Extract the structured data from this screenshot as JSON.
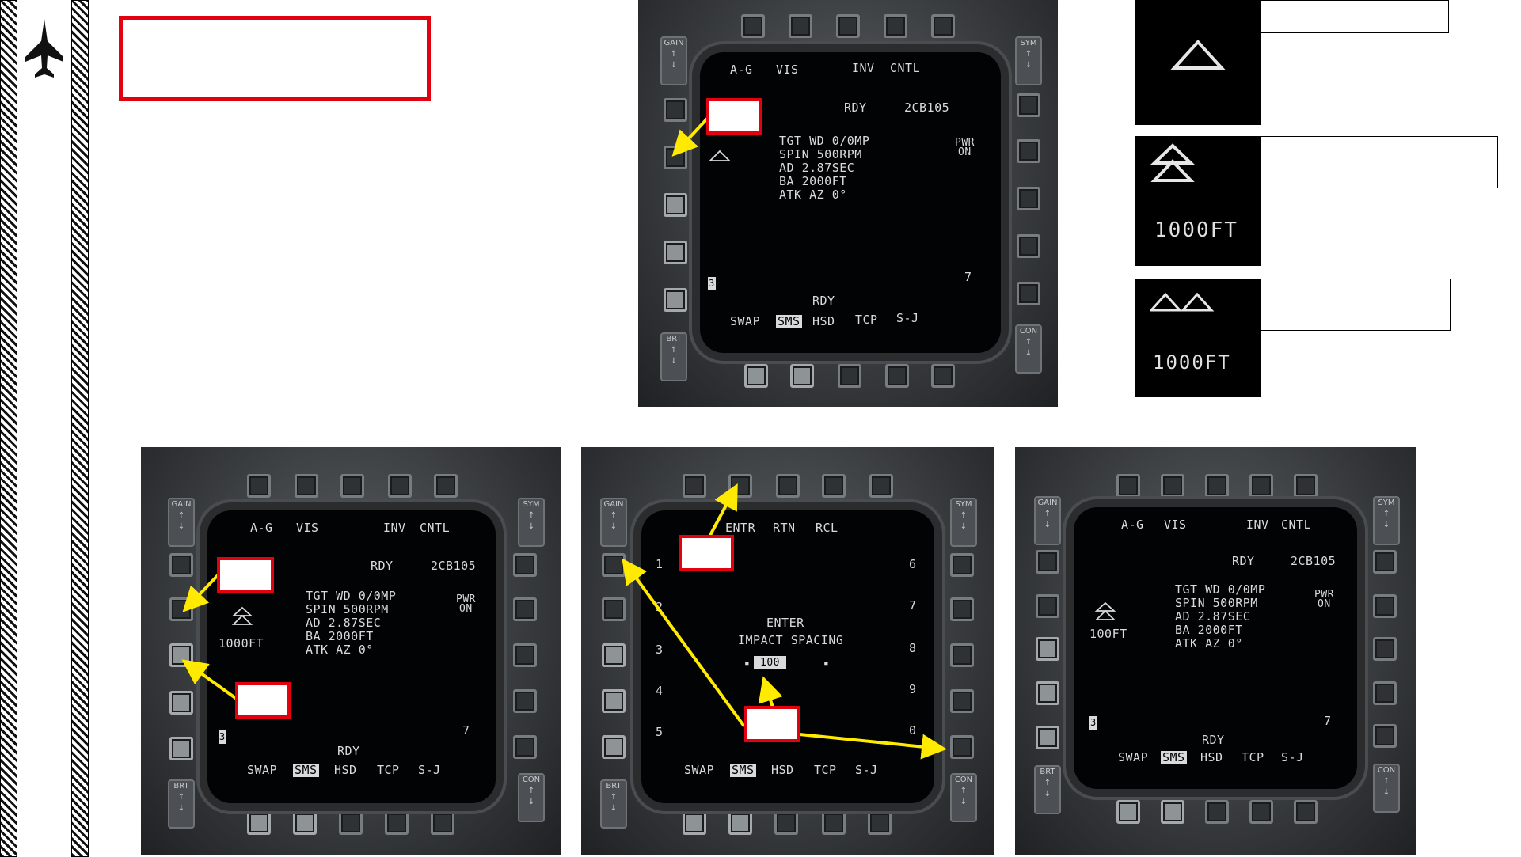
{
  "sidebar": {
    "icon": "jet-icon"
  },
  "title_box": {
    "text": ""
  },
  "symbols": {
    "single": {
      "label": ""
    },
    "pair": {
      "value": "1000FT",
      "label": ""
    },
    "ripple": {
      "value": "1000FT",
      "label": ""
    }
  },
  "mfd_top": {
    "tabs": [
      "A-G",
      "VIS",
      "INV",
      "CNTL"
    ],
    "rdy": "RDY",
    "code": "2CB105",
    "info": [
      "TGT WD 0/0MP",
      "SPIN 500RPM",
      "AD 2.87SEC",
      "BA 2000FT",
      "ATK AZ 0°"
    ],
    "pwr": [
      "PWR",
      "ON"
    ],
    "qty": "3",
    "station": "7",
    "rdy2": "RDY",
    "bottom": [
      "SWAP",
      "SMS",
      "HSD",
      "TCP",
      "S-J"
    ],
    "spacing": ""
  },
  "mfd_bl": {
    "tabs": [
      "A-G",
      "VIS",
      "INV",
      "CNTL"
    ],
    "rdy": "RDY",
    "code": "2CB105",
    "info": [
      "TGT WD 0/0MP",
      "SPIN 500RPM",
      "AD 2.87SEC",
      "BA 2000FT",
      "ATK AZ 0°"
    ],
    "pwr": [
      "PWR",
      "ON"
    ],
    "qty": "3",
    "station": "7",
    "rdy2": "RDY",
    "bottom": [
      "SWAP",
      "SMS",
      "HSD",
      "TCP",
      "S-J"
    ],
    "spacing": "1000FT"
  },
  "mfd_bm": {
    "top": [
      "ENTR",
      "RTN",
      "RCL"
    ],
    "left_nums": [
      "1",
      "2",
      "3",
      "4",
      "5"
    ],
    "right_nums": [
      "6",
      "7",
      "8",
      "9",
      "0"
    ],
    "prompt": [
      "ENTER",
      "IMPACT SPACING"
    ],
    "entry": "100",
    "bottom": [
      "SWAP",
      "SMS",
      "HSD",
      "TCP",
      "S-J"
    ]
  },
  "mfd_br": {
    "tabs": [
      "A-G",
      "VIS",
      "INV",
      "CNTL"
    ],
    "rdy": "RDY",
    "code": "2CB105",
    "info": [
      "TGT WD 0/0MP",
      "SPIN 500RPM",
      "AD 2.87SEC",
      "BA 2000FT",
      "ATK AZ 0°"
    ],
    "pwr": [
      "PWR",
      "ON"
    ],
    "qty": "3",
    "station": "7",
    "rdy2": "RDY",
    "bottom": [
      "SWAP",
      "SMS",
      "HSD",
      "TCP",
      "S-J"
    ],
    "spacing": "100FT"
  },
  "rockers": {
    "gain": "GAIN",
    "sym": "SYM",
    "brt": "BRT",
    "con": "CON"
  },
  "colors": {
    "accent": "#e3000f",
    "arrow": "#ffea00",
    "mfd_text": "#d8dadc"
  }
}
